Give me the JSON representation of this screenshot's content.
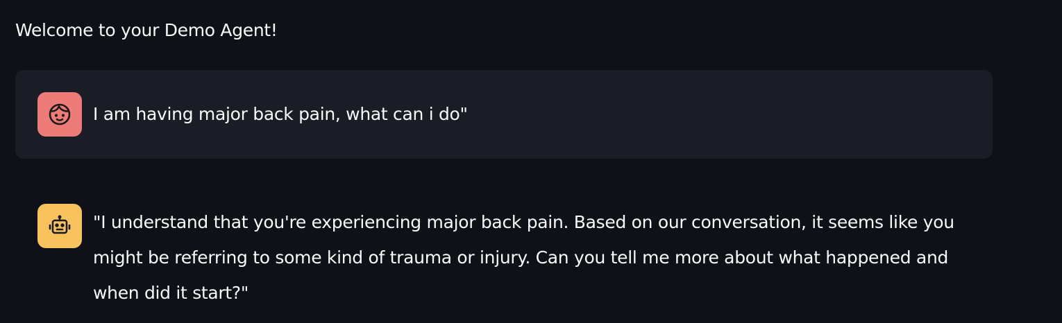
{
  "app": {
    "title": "Welcome to your Demo Agent!"
  },
  "messages": [
    {
      "role": "user",
      "avatar_icon": "face-icon",
      "avatar_color": "#ed7b78",
      "text": "I am having major back pain, what can i do\""
    },
    {
      "role": "assistant",
      "avatar_icon": "robot-icon",
      "avatar_color": "#f8c35c",
      "text": "\"I understand that you're experiencing major back pain. Based on our conversation, it seems like you might be referring to some kind of trauma or injury. Can you tell me more about what happened and when did it start?\""
    }
  ]
}
